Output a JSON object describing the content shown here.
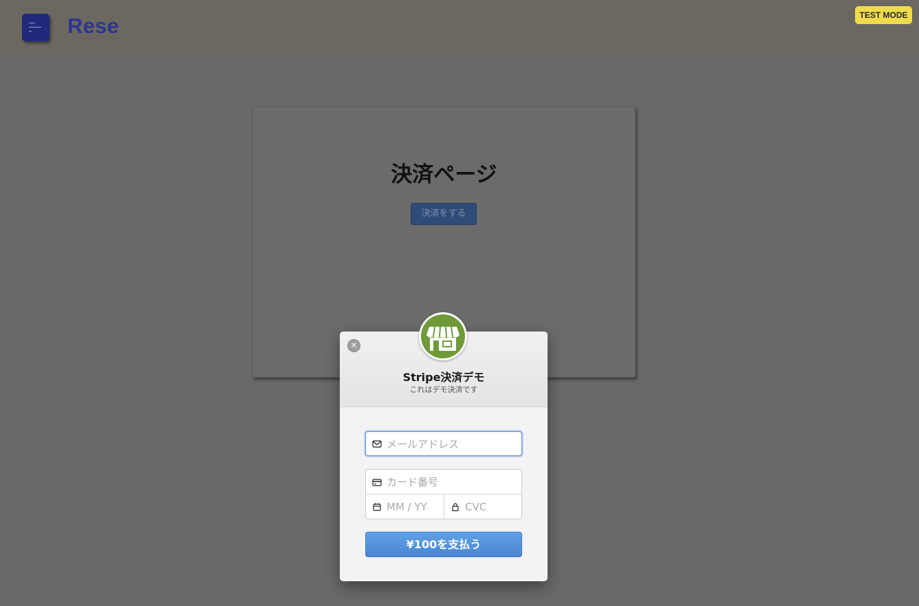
{
  "header": {
    "brand": "Rese",
    "test_mode": "TEST MODE"
  },
  "page": {
    "title": "決済ページ",
    "pay_button": "決済をする"
  },
  "checkout": {
    "title": "Stripe決済デモ",
    "subtitle": "これはデモ決済です",
    "close_symbol": "✕",
    "email_placeholder": "メールアドレス",
    "card_number_placeholder": "カード番号",
    "expiry_placeholder": "MM / YY",
    "cvc_placeholder": "CVC",
    "submit_label": "¥100を支払う"
  },
  "colors": {
    "overlay": "#696969",
    "brand": "#2a3590",
    "test_mode_badge": "#f0dc4a",
    "logo_green": "#6f9a3a",
    "submit_blue": "#4a86d2"
  },
  "icons": {
    "menu": "menu-icon",
    "close": "close-icon",
    "store": "store-icon",
    "email": "envelope-icon",
    "card": "credit-card-icon",
    "expiry": "calendar-icon",
    "cvc": "lock-icon"
  }
}
